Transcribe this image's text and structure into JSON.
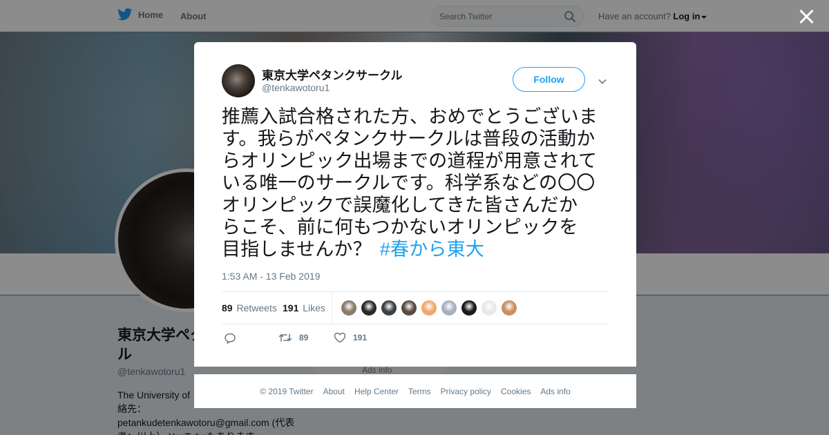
{
  "topbar": {
    "home_label": "Home",
    "about_label": "About",
    "search_placeholder": "Search Twitter",
    "have_account": "Have an account?",
    "login_label": "Log in"
  },
  "background_profile": {
    "name": "東京大学ペタ\nル",
    "handle": "@tenkawotoru1",
    "bio": "The University of \n絡先：\npetankudetenkawotoru@gmail.com (代表\n者：川上） YouTubeもあります↓",
    "ads_info": "Ads info"
  },
  "tweet": {
    "display_name": "東京大学ペタンクサークル",
    "handle": "@tenkawotoru1",
    "follow_label": "Follow",
    "text": "推薦入試合格された方、おめでとうございま\nす。我らがペタンクサークルは普段の活動か\nらオリンピック出場までの道程が用意されて\nいる唯一のサークルです。科学系などの〇〇\nオリンピックで誤魔化してきた皆さんだか\nらこそ、前に何もつかないオリンピックを\n目指しませんか？",
    "hashtag": "#春から東大",
    "timestamp": "1:53 AM - 13 Feb 2019",
    "retweet_count": "89",
    "retweets_label": "Retweets",
    "like_count": "191",
    "likes_label": "Likes",
    "action_retweet_count": "89",
    "action_like_count": "191"
  },
  "likers": [
    {
      "icon": "liker-avatar-1",
      "color": "#8a7a6a"
    },
    {
      "icon": "liker-avatar-2",
      "color": "#2a2a2a"
    },
    {
      "icon": "liker-avatar-3",
      "color": "#3a4048"
    },
    {
      "icon": "liker-avatar-4",
      "color": "#5a4a40"
    },
    {
      "icon": "liker-avatar-5",
      "color": "#f0a870"
    },
    {
      "icon": "liker-avatar-6",
      "color": "#a8b0c0"
    },
    {
      "icon": "liker-avatar-7",
      "color": "#1a1a1a"
    },
    {
      "icon": "liker-avatar-8",
      "color": "#e8e8e8"
    },
    {
      "icon": "liker-avatar-9",
      "color": "#c89060"
    }
  ],
  "footer": {
    "copyright": "© 2019 Twitter",
    "about": "About",
    "help": "Help Center",
    "terms": "Terms",
    "privacy": "Privacy policy",
    "cookies": "Cookies",
    "ads": "Ads info"
  },
  "colors": {
    "accent": "#1da1f2",
    "text_secondary": "#657786"
  }
}
